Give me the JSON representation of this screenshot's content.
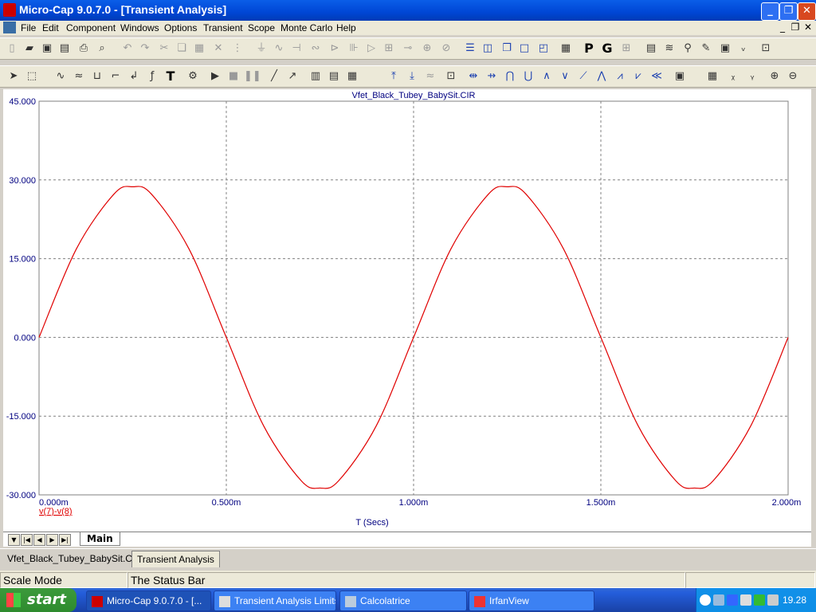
{
  "window": {
    "title": "Micro-Cap 9.0.7.0 - [Transient Analysis]",
    "minimize": "_",
    "restore": "❐",
    "close": "✕"
  },
  "menu": [
    "File",
    "Edit",
    "Component",
    "Windows",
    "Options",
    "Transient",
    "Scope",
    "Monte Carlo",
    "Help"
  ],
  "mdi_controls": {
    "minimize": "_",
    "restore": "❐",
    "close": "✕"
  },
  "toolbar1": {
    "p_label": "P",
    "g_label": "G"
  },
  "toolbar2": {
    "text_tool": "T"
  },
  "plot": {
    "title": "Vfet_Black_Tubey_BabySit.CIR",
    "xlabel": "T (Secs)",
    "legend": "v(7)-v(8)",
    "trace_color": "#e00000",
    "axis_text_color": "#000080"
  },
  "chart_data": {
    "type": "line",
    "title": "Vfet_Black_Tubey_BabySit.CIR",
    "xlabel": "T (Secs)",
    "ylabel": "",
    "x_ticks": [
      "0.000m",
      "0.500m",
      "1.000m",
      "1.500m",
      "2.000m"
    ],
    "y_ticks": [
      "45.000",
      "30.000",
      "15.000",
      "0.000",
      "-15.000",
      "-30.000"
    ],
    "xlim": [
      0,
      0.002
    ],
    "ylim": [
      -30,
      45
    ],
    "grid": true,
    "series": [
      {
        "name": "v(7)-v(8)",
        "x": [
          0,
          0.0001,
          0.0002,
          0.00025,
          0.0003,
          0.0004,
          0.0005,
          0.0006,
          0.0007,
          0.00075,
          0.0008,
          0.0009,
          0.001,
          0.0011,
          0.0012,
          0.00125,
          0.0013,
          0.0014,
          0.0015,
          0.0016,
          0.0017,
          0.00175,
          0.0018,
          0.0019,
          0.002
        ],
        "values": [
          0,
          16.9,
          27.3,
          28.7,
          27.3,
          16.9,
          0,
          -16.9,
          -27.3,
          -28.7,
          -27.3,
          -16.9,
          0,
          16.9,
          27.3,
          28.7,
          27.3,
          16.9,
          0,
          -16.9,
          -27.3,
          -28.7,
          -27.3,
          -16.9,
          0
        ]
      }
    ]
  },
  "plot_tabs": {
    "active": "Main"
  },
  "doc_tabs": [
    "Vfet_Black_Tubey_BabySit.CIR",
    "Transient Analysis"
  ],
  "status": {
    "mode": "Scale Mode",
    "message": "The Status Bar"
  },
  "taskbar": {
    "start": "start",
    "tasks": [
      "Micro-Cap 9.0.7.0 - [...",
      "Transient Analysis Limits",
      "Calcolatrice",
      "IrfanView"
    ],
    "clock": "19.28"
  }
}
